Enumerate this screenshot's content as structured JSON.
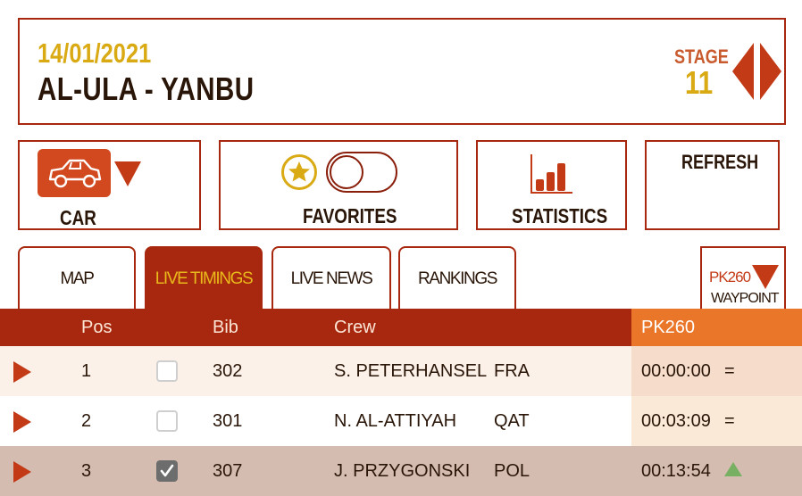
{
  "header": {
    "date": "14/01/2021",
    "route": "AL-ULA - YANBU",
    "stage_label": "STAGE",
    "stage_number": "11"
  },
  "controls": {
    "car_label": "CAR",
    "favorites_label": "FAVORITES",
    "favorites_toggle_on": false,
    "statistics_label": "STATISTICS",
    "refresh_label": "REFRESH"
  },
  "tabs": [
    {
      "label": "MAP",
      "active": false
    },
    {
      "label": "LIVE TIMINGS",
      "active": true
    },
    {
      "label": "LIVE NEWS",
      "active": false
    },
    {
      "label": "RANKINGS",
      "active": false
    }
  ],
  "waypoint": {
    "code": "PK260",
    "label": "WAYPOINT"
  },
  "table": {
    "columns": {
      "pos": "Pos",
      "bib": "Bib",
      "crew": "Crew",
      "checkpoint": "PK260"
    },
    "rows": [
      {
        "pos": "1",
        "bib": "302",
        "crew": "S. PETERHANSEL",
        "country": "FRA",
        "time": "00:00:00",
        "trend": "=",
        "favorite": false
      },
      {
        "pos": "2",
        "bib": "301",
        "crew": "N. AL-ATTIYAH",
        "country": "QAT",
        "time": "00:03:09",
        "trend": "=",
        "favorite": false
      },
      {
        "pos": "3",
        "bib": "307",
        "crew": "J. PRZYGONSKI",
        "country": "POL",
        "time": "00:13:54",
        "trend": "up-arrow-icon",
        "favorite": true
      }
    ]
  },
  "colors": {
    "brand_red": "#a8280f",
    "accent_orange": "#ea7629",
    "gold": "#d9aa14",
    "trend_up_green": "#77b062"
  }
}
